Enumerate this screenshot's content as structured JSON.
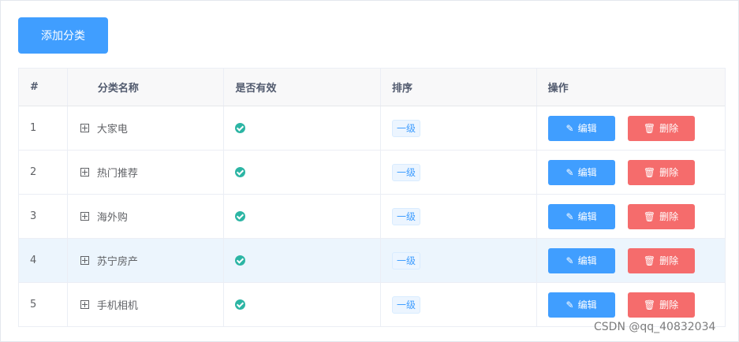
{
  "toolbar": {
    "add_label": "添加分类"
  },
  "table": {
    "headers": [
      "#",
      "分类名称",
      "是否有效",
      "排序",
      "操作"
    ],
    "rows": [
      {
        "index": "1",
        "name": "大家电",
        "level": "一级"
      },
      {
        "index": "2",
        "name": "热门推荐",
        "level": "一级"
      },
      {
        "index": "3",
        "name": "海外购",
        "level": "一级"
      },
      {
        "index": "4",
        "name": "苏宁房产",
        "level": "一级"
      },
      {
        "index": "5",
        "name": "手机相机",
        "level": "一级"
      }
    ],
    "edit_label": "编辑",
    "delete_label": "删除"
  },
  "watermark": "CSDN @qq_40832034",
  "colors": {
    "primary": "#409eff",
    "danger": "#f56c6c",
    "success": "#2cb5a4",
    "highlight": "#ecf5fd"
  }
}
